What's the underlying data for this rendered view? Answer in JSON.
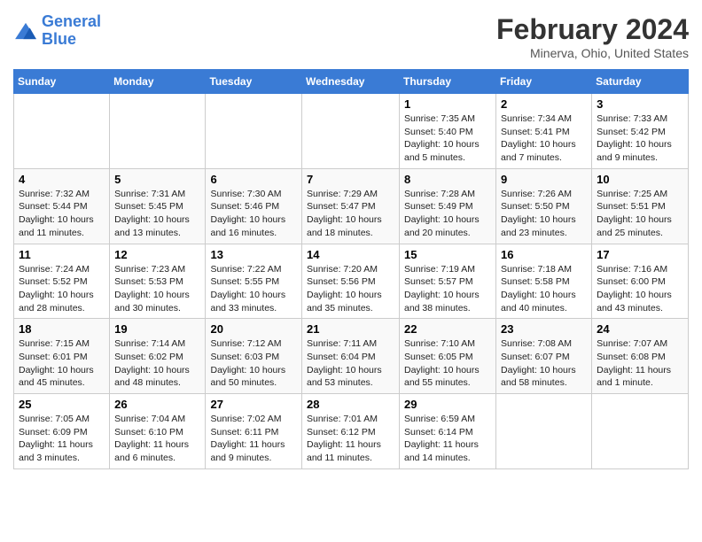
{
  "logo": {
    "line1": "General",
    "line2": "Blue"
  },
  "title": "February 2024",
  "subtitle": "Minerva, Ohio, United States",
  "days_of_week": [
    "Sunday",
    "Monday",
    "Tuesday",
    "Wednesday",
    "Thursday",
    "Friday",
    "Saturday"
  ],
  "weeks": [
    [
      {
        "day": "",
        "info": ""
      },
      {
        "day": "",
        "info": ""
      },
      {
        "day": "",
        "info": ""
      },
      {
        "day": "",
        "info": ""
      },
      {
        "day": "1",
        "info": "Sunrise: 7:35 AM\nSunset: 5:40 PM\nDaylight: 10 hours\nand 5 minutes."
      },
      {
        "day": "2",
        "info": "Sunrise: 7:34 AM\nSunset: 5:41 PM\nDaylight: 10 hours\nand 7 minutes."
      },
      {
        "day": "3",
        "info": "Sunrise: 7:33 AM\nSunset: 5:42 PM\nDaylight: 10 hours\nand 9 minutes."
      }
    ],
    [
      {
        "day": "4",
        "info": "Sunrise: 7:32 AM\nSunset: 5:44 PM\nDaylight: 10 hours\nand 11 minutes."
      },
      {
        "day": "5",
        "info": "Sunrise: 7:31 AM\nSunset: 5:45 PM\nDaylight: 10 hours\nand 13 minutes."
      },
      {
        "day": "6",
        "info": "Sunrise: 7:30 AM\nSunset: 5:46 PM\nDaylight: 10 hours\nand 16 minutes."
      },
      {
        "day": "7",
        "info": "Sunrise: 7:29 AM\nSunset: 5:47 PM\nDaylight: 10 hours\nand 18 minutes."
      },
      {
        "day": "8",
        "info": "Sunrise: 7:28 AM\nSunset: 5:49 PM\nDaylight: 10 hours\nand 20 minutes."
      },
      {
        "day": "9",
        "info": "Sunrise: 7:26 AM\nSunset: 5:50 PM\nDaylight: 10 hours\nand 23 minutes."
      },
      {
        "day": "10",
        "info": "Sunrise: 7:25 AM\nSunset: 5:51 PM\nDaylight: 10 hours\nand 25 minutes."
      }
    ],
    [
      {
        "day": "11",
        "info": "Sunrise: 7:24 AM\nSunset: 5:52 PM\nDaylight: 10 hours\nand 28 minutes."
      },
      {
        "day": "12",
        "info": "Sunrise: 7:23 AM\nSunset: 5:53 PM\nDaylight: 10 hours\nand 30 minutes."
      },
      {
        "day": "13",
        "info": "Sunrise: 7:22 AM\nSunset: 5:55 PM\nDaylight: 10 hours\nand 33 minutes."
      },
      {
        "day": "14",
        "info": "Sunrise: 7:20 AM\nSunset: 5:56 PM\nDaylight: 10 hours\nand 35 minutes."
      },
      {
        "day": "15",
        "info": "Sunrise: 7:19 AM\nSunset: 5:57 PM\nDaylight: 10 hours\nand 38 minutes."
      },
      {
        "day": "16",
        "info": "Sunrise: 7:18 AM\nSunset: 5:58 PM\nDaylight: 10 hours\nand 40 minutes."
      },
      {
        "day": "17",
        "info": "Sunrise: 7:16 AM\nSunset: 6:00 PM\nDaylight: 10 hours\nand 43 minutes."
      }
    ],
    [
      {
        "day": "18",
        "info": "Sunrise: 7:15 AM\nSunset: 6:01 PM\nDaylight: 10 hours\nand 45 minutes."
      },
      {
        "day": "19",
        "info": "Sunrise: 7:14 AM\nSunset: 6:02 PM\nDaylight: 10 hours\nand 48 minutes."
      },
      {
        "day": "20",
        "info": "Sunrise: 7:12 AM\nSunset: 6:03 PM\nDaylight: 10 hours\nand 50 minutes."
      },
      {
        "day": "21",
        "info": "Sunrise: 7:11 AM\nSunset: 6:04 PM\nDaylight: 10 hours\nand 53 minutes."
      },
      {
        "day": "22",
        "info": "Sunrise: 7:10 AM\nSunset: 6:05 PM\nDaylight: 10 hours\nand 55 minutes."
      },
      {
        "day": "23",
        "info": "Sunrise: 7:08 AM\nSunset: 6:07 PM\nDaylight: 10 hours\nand 58 minutes."
      },
      {
        "day": "24",
        "info": "Sunrise: 7:07 AM\nSunset: 6:08 PM\nDaylight: 11 hours\nand 1 minute."
      }
    ],
    [
      {
        "day": "25",
        "info": "Sunrise: 7:05 AM\nSunset: 6:09 PM\nDaylight: 11 hours\nand 3 minutes."
      },
      {
        "day": "26",
        "info": "Sunrise: 7:04 AM\nSunset: 6:10 PM\nDaylight: 11 hours\nand 6 minutes."
      },
      {
        "day": "27",
        "info": "Sunrise: 7:02 AM\nSunset: 6:11 PM\nDaylight: 11 hours\nand 9 minutes."
      },
      {
        "day": "28",
        "info": "Sunrise: 7:01 AM\nSunset: 6:12 PM\nDaylight: 11 hours\nand 11 minutes."
      },
      {
        "day": "29",
        "info": "Sunrise: 6:59 AM\nSunset: 6:14 PM\nDaylight: 11 hours\nand 14 minutes."
      },
      {
        "day": "",
        "info": ""
      },
      {
        "day": "",
        "info": ""
      }
    ]
  ]
}
